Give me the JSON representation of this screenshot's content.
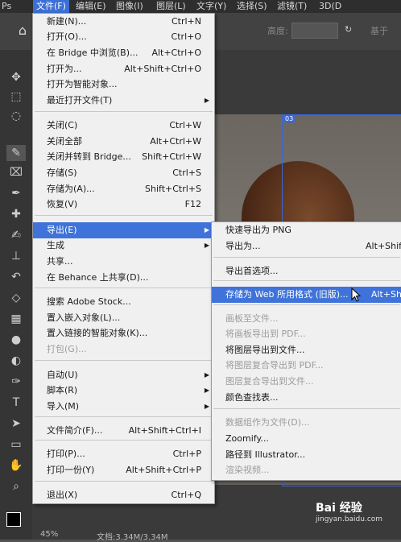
{
  "menubar": {
    "items": [
      "文件(F)",
      "编辑(E)",
      "图像(I)",
      "图层(L)",
      "文字(Y)",
      "选择(S)",
      "滤镜(T)",
      "3D(D"
    ]
  },
  "options": {
    "label1": "高度:",
    "label2": "基于",
    "home_icon": "home-icon"
  },
  "file_menu": {
    "items": [
      {
        "label": "新建(N)...",
        "shortcut": "Ctrl+N"
      },
      {
        "label": "打开(O)...",
        "shortcut": "Ctrl+O"
      },
      {
        "label": "在 Bridge 中浏览(B)...",
        "shortcut": "Alt+Ctrl+O"
      },
      {
        "label": "打开为...",
        "shortcut": "Alt+Shift+Ctrl+O"
      },
      {
        "label": "打开为智能对象...",
        "shortcut": ""
      },
      {
        "label": "最近打开文件(T)",
        "shortcut": ""
      },
      {
        "label": "关闭(C)",
        "shortcut": "Ctrl+W"
      },
      {
        "label": "关闭全部",
        "shortcut": "Alt+Ctrl+W"
      },
      {
        "label": "关闭并转到 Bridge...",
        "shortcut": "Shift+Ctrl+W"
      },
      {
        "label": "存储(S)",
        "shortcut": "Ctrl+S"
      },
      {
        "label": "存储为(A)...",
        "shortcut": "Shift+Ctrl+S"
      },
      {
        "label": "恢复(V)",
        "shortcut": "F12"
      },
      {
        "label": "导出(E)",
        "shortcut": ""
      },
      {
        "label": "生成",
        "shortcut": ""
      },
      {
        "label": "共享...",
        "shortcut": ""
      },
      {
        "label": "在 Behance 上共享(D)...",
        "shortcut": ""
      },
      {
        "label": "搜索 Adobe Stock...",
        "shortcut": ""
      },
      {
        "label": "置入嵌入对象(L)...",
        "shortcut": ""
      },
      {
        "label": "置入链接的智能对象(K)...",
        "shortcut": ""
      },
      {
        "label": "打包(G)...",
        "shortcut": ""
      },
      {
        "label": "自动(U)",
        "shortcut": ""
      },
      {
        "label": "脚本(R)",
        "shortcut": ""
      },
      {
        "label": "导入(M)",
        "shortcut": ""
      },
      {
        "label": "文件简介(F)...",
        "shortcut": "Alt+Shift+Ctrl+I"
      },
      {
        "label": "打印(P)...",
        "shortcut": "Ctrl+P"
      },
      {
        "label": "打印一份(Y)",
        "shortcut": "Alt+Shift+Ctrl+P"
      },
      {
        "label": "退出(X)",
        "shortcut": "Ctrl+Q"
      }
    ]
  },
  "export_menu": {
    "items": [
      {
        "label": "快速导出为 PNG",
        "shortcut": ""
      },
      {
        "label": "导出为...",
        "shortcut": "Alt+Shif"
      },
      {
        "label": "导出首选项...",
        "shortcut": ""
      },
      {
        "label": "存储为 Web 所用格式 (旧版)...",
        "shortcut": "Alt+Sh"
      },
      {
        "label": "画板至文件...",
        "shortcut": ""
      },
      {
        "label": "将画板导出到 PDF...",
        "shortcut": ""
      },
      {
        "label": "将图层导出到文件...",
        "shortcut": ""
      },
      {
        "label": "将图层复合导出到 PDF...",
        "shortcut": ""
      },
      {
        "label": "图层复合导出到文件...",
        "shortcut": ""
      },
      {
        "label": "颜色查找表...",
        "shortcut": ""
      },
      {
        "label": "数据组作为文件(D)...",
        "shortcut": ""
      },
      {
        "label": "Zoomify...",
        "shortcut": ""
      },
      {
        "label": "路径到 Illustrator...",
        "shortcut": ""
      },
      {
        "label": "渲染视频...",
        "shortcut": ""
      }
    ]
  },
  "canvas": {
    "artboard_label": "03"
  },
  "status": {
    "zoom": "45%",
    "doc": "文档:3.34M/3.34M"
  },
  "watermark": {
    "brand": "Bai  经验",
    "site": "jingyan.baidu.com"
  },
  "colors": {
    "highlight": "#3f73d9",
    "menu_bg": "#f0f0f0"
  }
}
